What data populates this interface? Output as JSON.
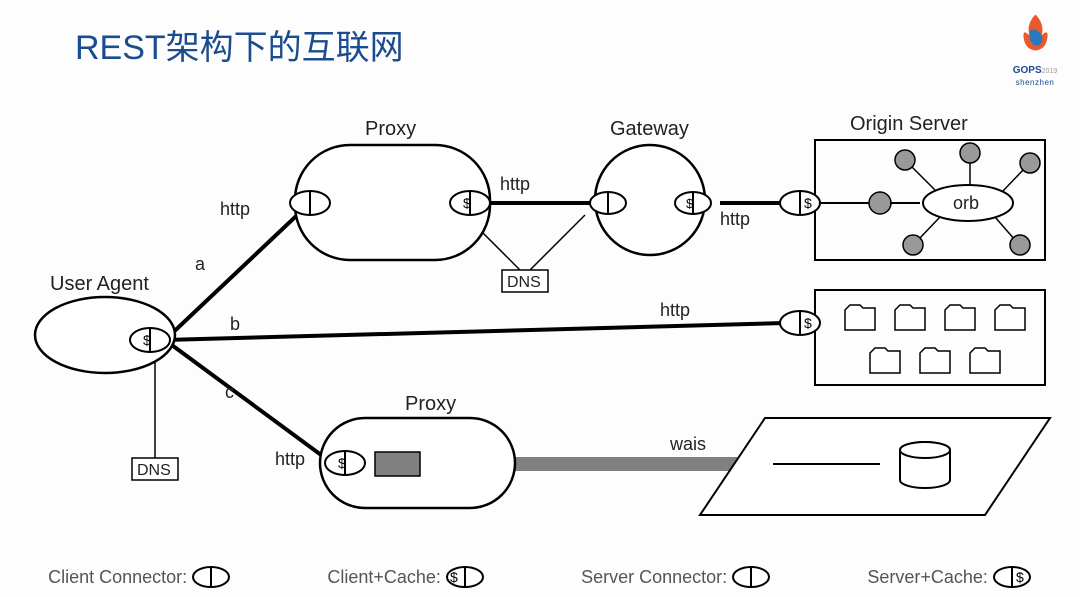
{
  "title": "REST架构下的互联网",
  "logo": {
    "brand": "GOPS",
    "year": "2019",
    "location": "shenzhen"
  },
  "nodes": {
    "userAgent": "User Agent",
    "proxy1": "Proxy",
    "gateway": "Gateway",
    "originServer": "Origin Server",
    "proxy2": "Proxy",
    "orb": "orb"
  },
  "edges": {
    "ua_proxy1": "http",
    "proxy1_gateway": "http",
    "gateway_origin": "http",
    "ua_files": "http",
    "ua_proxy2": "http",
    "proxy2_db": "wais",
    "a": "a",
    "b": "b",
    "c": "c"
  },
  "labels": {
    "dns1": "DNS",
    "dns2": "DNS"
  },
  "legend": {
    "clientConnector": "Client Connector:",
    "clientCache": "Client+Cache:",
    "serverConnector": "Server Connector:",
    "serverCache": "Server+Cache:"
  }
}
